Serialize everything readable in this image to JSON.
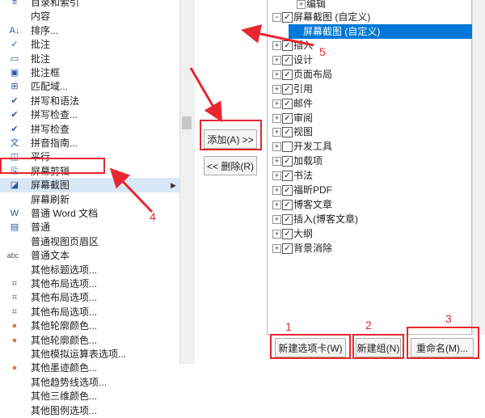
{
  "left_list": [
    {
      "label": "目录和索引",
      "icon": "index-icon",
      "glyph": "≡"
    },
    {
      "label": "内容",
      "icon": "blank-icon",
      "glyph": ""
    },
    {
      "label": "排序...",
      "icon": "sort-az-icon",
      "glyph": "A↓"
    },
    {
      "label": "批注",
      "icon": "check-icon",
      "glyph": "✓"
    },
    {
      "label": "批注",
      "icon": "comment-icon",
      "glyph": "▭"
    },
    {
      "label": "批注框",
      "icon": "comment-box-icon",
      "glyph": "▣"
    },
    {
      "label": "匹配域...",
      "icon": "match-field-icon",
      "glyph": "⊞"
    },
    {
      "label": "拼写和语法",
      "icon": "spelling-grammar-icon",
      "glyph": "✔"
    },
    {
      "label": "拼写检查...",
      "icon": "spell-check-icon",
      "glyph": "✔"
    },
    {
      "label": "拼写检查",
      "icon": "spell-check-icon",
      "glyph": "✔"
    },
    {
      "label": "拼音指南...",
      "icon": "phonetic-guide-icon",
      "glyph": "文"
    },
    {
      "label": "平行",
      "icon": "parallel-icon",
      "glyph": "◫"
    },
    {
      "label": "屏幕剪辑",
      "icon": "screen-clip-icon",
      "glyph": "⎘"
    },
    {
      "label": "屏幕截图",
      "icon": "screenshot-icon",
      "glyph": "◪",
      "selected": true,
      "submenu": true
    },
    {
      "label": "屏幕刷新",
      "icon": "blank-icon",
      "glyph": ""
    },
    {
      "label": "普通 Word 文档",
      "icon": "word-doc-icon",
      "glyph": "W"
    },
    {
      "label": "普通",
      "icon": "normal-icon",
      "glyph": "▤"
    },
    {
      "label": "普通视图页眉区",
      "icon": "blank-icon",
      "glyph": ""
    },
    {
      "label": "普通文本",
      "icon": "abc-icon",
      "glyph": "abc"
    },
    {
      "label": "其他标题选项...",
      "icon": "blank-icon",
      "glyph": ""
    },
    {
      "label": "其他布局选项...",
      "icon": "layout-icon",
      "glyph": "⌗"
    },
    {
      "label": "其他布局选项...",
      "icon": "layout-icon",
      "glyph": "⌗"
    },
    {
      "label": "其他布局选项...",
      "icon": "layout-icon",
      "glyph": "⌗"
    },
    {
      "label": "其他轮廓颜色...",
      "icon": "color-wheel-icon",
      "glyph": "●"
    },
    {
      "label": "其他轮廓颜色...",
      "icon": "color-wheel-icon",
      "glyph": "●"
    },
    {
      "label": "其他模拟运算表选项...",
      "icon": "blank-icon",
      "glyph": ""
    },
    {
      "label": "其他墨迹颜色...",
      "icon": "color-wheel-icon",
      "glyph": "●"
    },
    {
      "label": "其他趋势线选项...",
      "icon": "blank-icon",
      "glyph": ""
    },
    {
      "label": "其他三维颜色...",
      "icon": "blank-icon",
      "glyph": ""
    },
    {
      "label": "其他图例选项...",
      "icon": "blank-icon",
      "glyph": ""
    }
  ],
  "buttons": {
    "add": "添加(A) >>",
    "remove": "<< 删除(R)",
    "new_tab": "新建选项卡(W)",
    "new_group": "新建组(N)",
    "rename": "重命名(M)..."
  },
  "tree": {
    "top_item": "编辑",
    "custom_tab": "屏幕截图 (自定义)",
    "custom_group": "屏幕截图 (自定义)",
    "tabs": [
      "插入",
      "设计",
      "页面布局",
      "引用",
      "邮件",
      "审阅",
      "视图",
      "开发工具",
      "加载项",
      "书法",
      "福昕PDF",
      "博客文章",
      "插入(博客文章)",
      "大纲",
      "背景消除"
    ],
    "unchecked": [
      "开发工具"
    ]
  },
  "annotations": [
    "1",
    "2",
    "3",
    "4",
    "5"
  ],
  "colors": {
    "annotation": "#e8262f",
    "selection": "#0078d7",
    "row_highlight": "#d9e8f7"
  }
}
